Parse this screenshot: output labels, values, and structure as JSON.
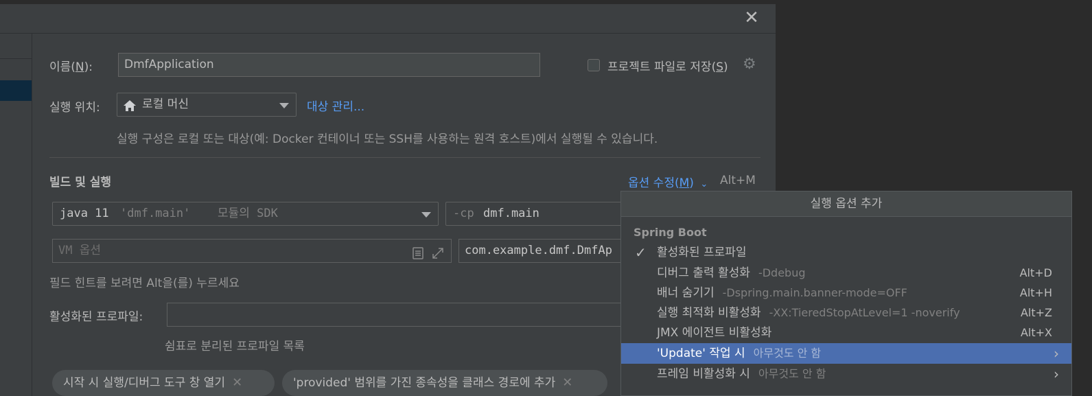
{
  "dialog": {
    "close_glyph": "✕"
  },
  "form": {
    "name_label": "이름(",
    "name_mnemonic": "N",
    "name_label_end": "):",
    "name_value": "DmfApplication",
    "save_checkbox_label": "프로젝트 파일로 저장(",
    "save_mnemonic": "S",
    "save_label_end": ")",
    "run_on_label": "실행 위치:",
    "run_on_value": "로컬 머신",
    "manage_targets_link": "대상 관리...",
    "run_on_hint": "실행 구성은 로컬 또는 대상(예: Docker 컨테이너 또는 SSH를 사용하는 원격 호스트)에서 실행될 수 있습니다.",
    "build_run_heading": "빌드 및 실행",
    "modify_options_link": "옵션 수정(",
    "modify_options_mnemonic": "M",
    "modify_options_end": ")",
    "modify_options_shortcut": "Alt+M",
    "sdk_java": "java 11",
    "sdk_module": "'dmf.main'",
    "sdk_suffix": "모듈의 SDK",
    "cp_flag": "-cp",
    "cp_value": "dmf.main",
    "vm_options_placeholder": "VM 옵션",
    "main_class_value": "com.example.dmf.DmfAp",
    "field_hint": "필드 힌트를 보려면 Alt을(를) 누르세요",
    "active_profiles_label": "활성화된 프로파일:",
    "active_profiles_value": "",
    "active_profiles_hint": "쉼표로 분리된 프로파일 목록",
    "chips": [
      {
        "label": "시작 시 실행/디버그 도구 창 열기"
      },
      {
        "label": "'provided' 범위를 가진 종속성을 클래스 경로에 추가"
      }
    ]
  },
  "popup": {
    "title": "실행 옵션 추가",
    "group": "Spring Boot",
    "items": [
      {
        "label": "활성화된 프로파일",
        "sub": "",
        "shortcut": "",
        "checked": true
      },
      {
        "label": "디버그 출력 활성화",
        "sub": "-Ddebug",
        "shortcut": "Alt+D"
      },
      {
        "label": "배너 숨기기",
        "sub": "-Dspring.main.banner-mode=OFF",
        "shortcut": "Alt+H"
      },
      {
        "label": "실행 최적화 비활성화",
        "sub": "-XX:TieredStopAtLevel=1 -noverify",
        "shortcut": "Alt+Z"
      },
      {
        "label": "JMX 에이전트 비활성화",
        "sub": "",
        "shortcut": "Alt+X"
      },
      {
        "label": "'Update' 작업 시",
        "sub": "아무것도 안 함",
        "shortcut": "",
        "submenu": true,
        "selected": true
      },
      {
        "label": "프레임 비활성화 시",
        "sub": "아무것도 안 함",
        "shortcut": "",
        "submenu": true
      }
    ]
  },
  "colors": {
    "accent_link": "#589df6",
    "selection": "#4b6eaf",
    "dialog_bg": "#3c3f41"
  }
}
